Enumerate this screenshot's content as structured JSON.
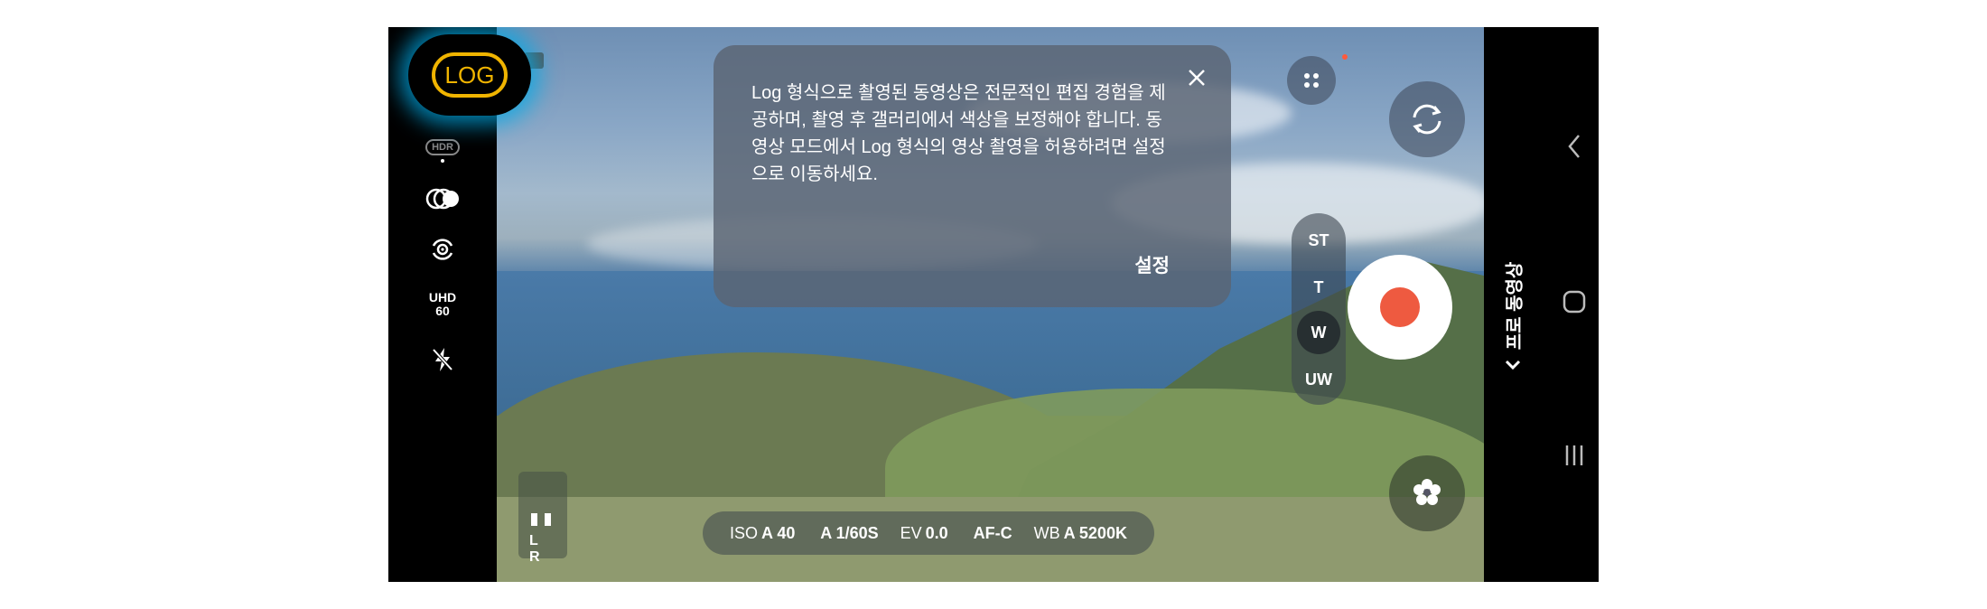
{
  "left_toolbar": {
    "log_label": "LOG",
    "hdr_label": "HDR",
    "resolution_line1": "UHD",
    "resolution_line2": "60"
  },
  "dialog": {
    "message": "Log 형식으로 촬영된 동영상은 전문적인 편집 경험을 제공하며, 촬영 후 갤러리에서 색상을 보정해야 합니다. 동영상 모드에서 Log 형식의 영상 촬영을 허용하려면 설정으로 이동하세요.",
    "settings_button": "설정"
  },
  "lenses": [
    "ST",
    "T",
    "W",
    "UW"
  ],
  "active_lens": "W",
  "audio": {
    "label": "L R"
  },
  "settings_bar": [
    {
      "label": "ISO",
      "value": "A 40"
    },
    {
      "label": "",
      "value": "A 1/60S"
    },
    {
      "label": "EV",
      "value": "0.0"
    },
    {
      "label": "",
      "value": "AF-C"
    },
    {
      "label": "WB",
      "value": "A 5200K"
    }
  ],
  "mode": {
    "label": "프로 동영상"
  },
  "colors": {
    "log_accent": "#f0b400",
    "log_glow": "#00aae6",
    "record": "#ee5a40"
  },
  "icons": [
    "log-icon",
    "hdr-icon",
    "filter-icon",
    "stabilization-icon",
    "flash-off-icon",
    "close-icon",
    "more-dots-icon",
    "switch-camera-icon",
    "record-icon",
    "effects-flower-icon",
    "chevron-down-icon",
    "back-icon",
    "home-icon",
    "recents-icon"
  ]
}
